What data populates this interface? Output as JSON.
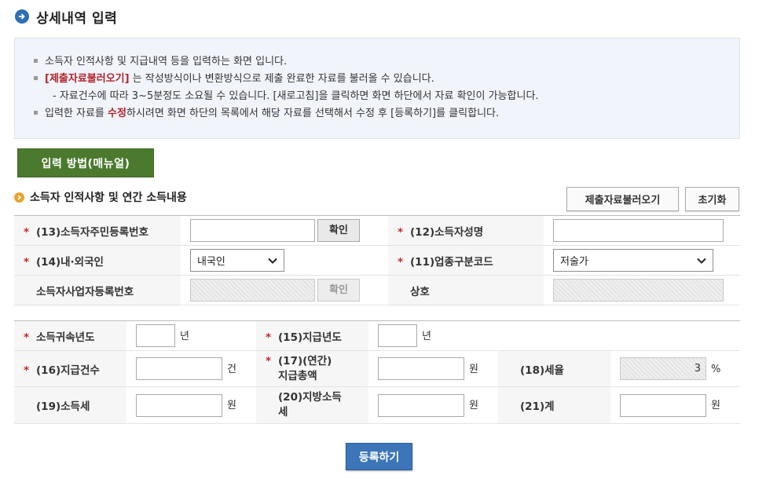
{
  "page": {
    "title": "상세내역 입력"
  },
  "info": {
    "line1": "소득자 인적사항 및 지급내역 등을 입력하는 화면 입니다.",
    "line2_em": "[제출자료불러오기]",
    "line2_rest": " 는 작성방식이나 변환방식으로 제출 완료한 자료를 불러올 수 있습니다.",
    "line3": "- 자료건수에 따라 3~5분정도 소요될 수 있습니다. [새로고침]을 클릭하면 화면 하단에서 자료 확인이 가능합니다.",
    "line4_a": "입력한 자료를 ",
    "line4_em": "수정",
    "line4_b": "하시려면 화면 하단의 목록에서 해당 자료를 선택해서 수정 후 [등록하기]를 클릭합니다."
  },
  "buttons": {
    "input_method": "입력 방법(매뉴얼)",
    "load_submitted": "제출자료불러오기",
    "reset": "초기화",
    "confirm": "확인",
    "register": "등록하기"
  },
  "section": {
    "title": "소득자 인적사항 및 연간 소득내용"
  },
  "required_mark": "*",
  "form1": {
    "resident_no_label": "(13)소득자주민등록번호",
    "resident_no_value": "",
    "name_label": "(12)소득자성명",
    "name_value": "",
    "nationality_label": "(14)내·외국인",
    "nationality_value": "내국인",
    "industry_label": "(11)업종구분코드",
    "industry_value": "저술가",
    "biz_no_label": "소득자사업자등록번호",
    "trade_name_label": "상호"
  },
  "form2": {
    "belong_year_label": "소득귀속년도",
    "belong_year_value": "",
    "pay_year_label": "(15)지급년도",
    "pay_year_value": "",
    "pay_count_label": "(16)지급건수",
    "pay_count_value": "",
    "total_label_1": "(17)(연간)",
    "total_label_2": "지급총액",
    "total_value": "",
    "rate_label": "(18)세율",
    "rate_value": "3",
    "income_tax_label": "(19)소득세",
    "income_tax_value": "",
    "local_tax_label_1": "(20)지방소득",
    "local_tax_label_2": "세",
    "local_tax_value": "",
    "sum_label": "(21)계",
    "sum_value": ""
  },
  "units": {
    "year": "년",
    "count": "건",
    "won": "원",
    "percent": "%"
  },
  "colors": {
    "accent_blue": "#3c76b8",
    "accent_green": "#4b7a2e",
    "required_red": "#c0282d",
    "info_bg": "#f1f5fb"
  }
}
